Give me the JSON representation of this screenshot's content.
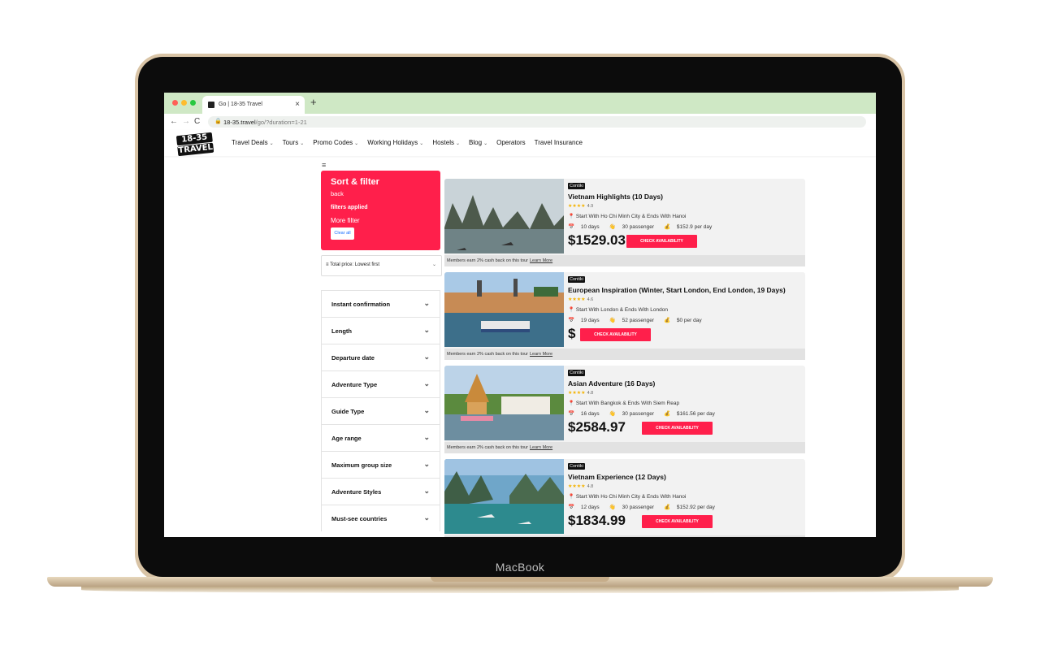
{
  "device": {
    "label": "MacBook"
  },
  "browser": {
    "tab_title": "Go | 18-35 Travel",
    "tab_close": "×",
    "new_tab": "+",
    "url_host": "18-35.travel",
    "url_path": "/go/?duration=1-21",
    "nav_icons": [
      "arrow-left-icon",
      "arrow-right-icon",
      "reload-icon",
      "lock-icon"
    ],
    "traffic_lights": [
      "#ff5f57",
      "#febc2e",
      "#28c840"
    ]
  },
  "site": {
    "logo_lines": [
      "18-35",
      "TRAVEL"
    ],
    "menu": [
      {
        "label": "Travel Deals",
        "caret": true
      },
      {
        "label": "Tours",
        "caret": true
      },
      {
        "label": "Promo Codes",
        "caret": true
      },
      {
        "label": "Working Holidays",
        "caret": true
      },
      {
        "label": "Hostels",
        "caret": true
      },
      {
        "label": "Blog",
        "caret": true
      },
      {
        "label": "Operators",
        "caret": false
      },
      {
        "label": "Travel Insurance",
        "caret": false
      }
    ],
    "caret_glyph": "⌄",
    "hamburger": "≡"
  },
  "sidebar": {
    "sort_filter": {
      "heading": "Sort & filter",
      "back": "back",
      "filters_applied": "filters applied",
      "more_filter": "More filter",
      "clear_all": "Clear all"
    },
    "sort_select": {
      "icon": "≡",
      "value": "Total price: Lowest first",
      "chevron": "⌄"
    },
    "filters": [
      "Instant confirmation",
      "Length",
      "Departure date",
      "Adventure Type",
      "Guide Type",
      "Age range",
      "Maximum group size",
      "Adventure Styles",
      "Must-see countries"
    ],
    "filter_chevron": "⌄"
  },
  "tours": [
    {
      "operator": "Contiki",
      "title": "Vietnam Highlights (10 Days)",
      "rating": "4.9",
      "location": "Start With Ho Chi Minh City & Ends With Hanoi",
      "days": "10 days",
      "passengers": "30 passenger",
      "per_day": "$152.9 per day",
      "price": "$1529.03",
      "cta": "CHECK AVAILABILITY",
      "cashback": "Members earn 2% cash back on this tour",
      "learn_more": "Learn More",
      "image": "halong-bay"
    },
    {
      "operator": "Contiki",
      "title": "European Inspiration (Winter, Start London, End London, 19 Days)",
      "rating": "4.6",
      "location": "Start With London & Ends With London",
      "days": "19 days",
      "passengers": "52 passenger",
      "per_day": "$0 per day",
      "price": "$",
      "cta": "CHECK AVAILABILITY",
      "cashback": "Members earn 2% cash back on this tour",
      "learn_more": "Learn More",
      "image": "prague-river"
    },
    {
      "operator": "Contiki",
      "title": "Asian Adventure (16 Days)",
      "rating": "4.8",
      "location": "Start With Bangkok & Ends With Siem Reap",
      "days": "16 days",
      "passengers": "30 passenger",
      "per_day": "$161.56 per day",
      "price": "$2584.97",
      "cta": "CHECK AVAILABILITY",
      "cashback": "Members earn 2% cash back on this tour",
      "learn_more": "Learn More",
      "image": "thai-temple"
    },
    {
      "operator": "Contiki",
      "title": "Vietnam Experience (12 Days)",
      "rating": "4.8",
      "location": "Start With Ho Chi Minh City & Ends With Hanoi",
      "days": "12 days",
      "passengers": "30 passenger",
      "per_day": "$152.92 per day",
      "price": "$1834.99",
      "cta": "CHECK AVAILABILITY",
      "cashback": "",
      "learn_more": "",
      "image": "halong-bay-aerial"
    }
  ],
  "icons": {
    "star": "★",
    "pin": "📍",
    "calendar": "📅",
    "hand": "👋",
    "moneybag": "💰"
  }
}
